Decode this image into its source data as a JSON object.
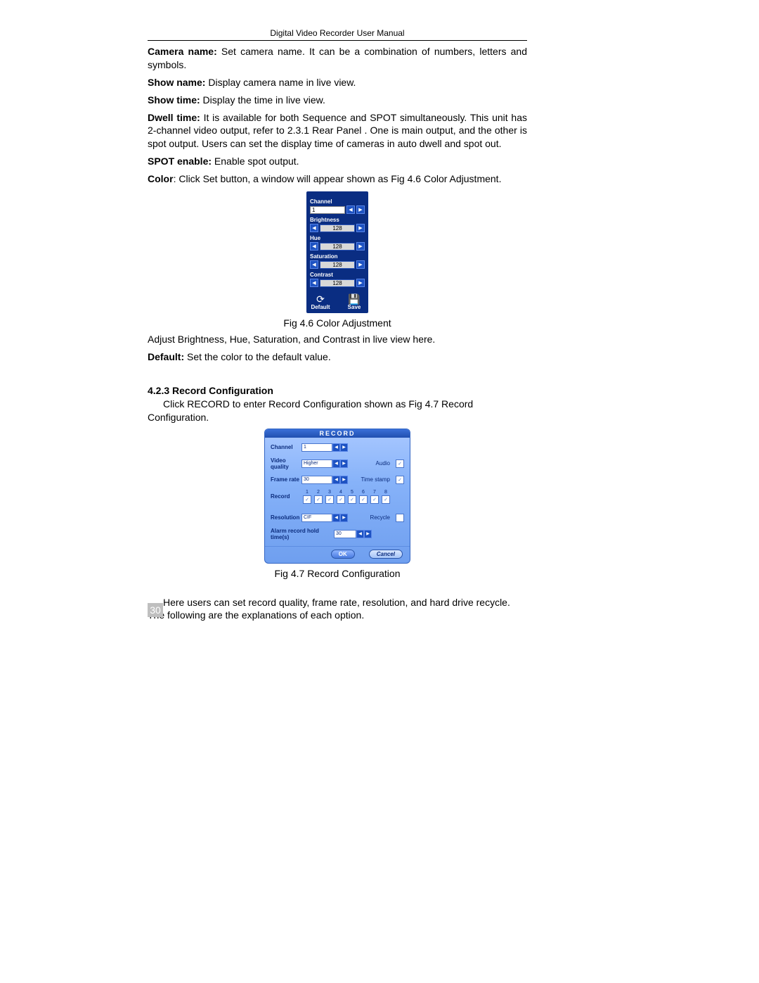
{
  "header": {
    "title": "Digital Video Recorder User Manual"
  },
  "page_number": "30",
  "defs": {
    "camera_name": {
      "label": "Camera name:",
      "text": " Set camera name. It can be a combination of numbers, letters and symbols."
    },
    "show_name": {
      "label": "Show name:",
      "text": " Display camera name in live view."
    },
    "show_time": {
      "label": "Show time:",
      "text": " Display the time in live view."
    },
    "dwell_time": {
      "label": "Dwell time:",
      "text": " It is available for both Sequence and SPOT simultaneously. This unit has 2-channel video output, refer to 2.3.1 Rear Panel . One is main output, and the other is spot output. Users can set the display time of cameras in auto dwell and spot out."
    },
    "spot_enable": {
      "label": "SPOT enable:",
      "text": " Enable spot output."
    },
    "color": {
      "label": "Color",
      "text": ": Click Set button, a window will appear shown as Fig 4.6    Color Adjustment."
    }
  },
  "fig46": {
    "caption": "Fig 4.6    Color Adjustment",
    "panel": {
      "channel_label": "Channel",
      "channel_value": "1",
      "sliders": [
        {
          "label": "Brightness",
          "value": "128"
        },
        {
          "label": "Hue",
          "value": "128"
        },
        {
          "label": "Saturation",
          "value": "128"
        },
        {
          "label": "Contrast",
          "value": "128"
        }
      ],
      "default_btn": "Default",
      "save_btn": "Save"
    },
    "after": "Adjust Brightness, Hue, Saturation, and Contrast in live view here."
  },
  "default_line": {
    "label": "Default:",
    "text": " Set the color to the default value."
  },
  "section423": {
    "title": "4.2.3  Record Configuration",
    "intro": "Click RECORD to enter Record Configuration shown as Fig 4.7    Record Configuration."
  },
  "fig47": {
    "caption": "Fig 4.7    Record Configuration",
    "panel": {
      "title": "RECORD",
      "rows": {
        "channel": {
          "label": "Channel",
          "value": "1"
        },
        "video_quality": {
          "label": "Video quality",
          "value": "Higher"
        },
        "frame_rate": {
          "label": "Frame rate",
          "value": "30"
        },
        "audio": {
          "label": "Audio",
          "checked": true
        },
        "time_stamp": {
          "label": "Time stamp",
          "checked": true
        },
        "record": {
          "label": "Record",
          "channels": [
            "1",
            "2",
            "3",
            "4",
            "5",
            "6",
            "7",
            "8"
          ]
        },
        "resolution": {
          "label": "Resolution",
          "value": "CIF"
        },
        "recycle": {
          "label": "Recycle",
          "checked": false
        },
        "alarm_hold": {
          "label": "Alarm record hold time(s)",
          "value": "30"
        }
      },
      "ok": "OK",
      "cancel": "Cancel"
    }
  },
  "closing": "Here users can set record quality, frame rate, resolution, and hard drive recycle. The following are the explanations of each option."
}
